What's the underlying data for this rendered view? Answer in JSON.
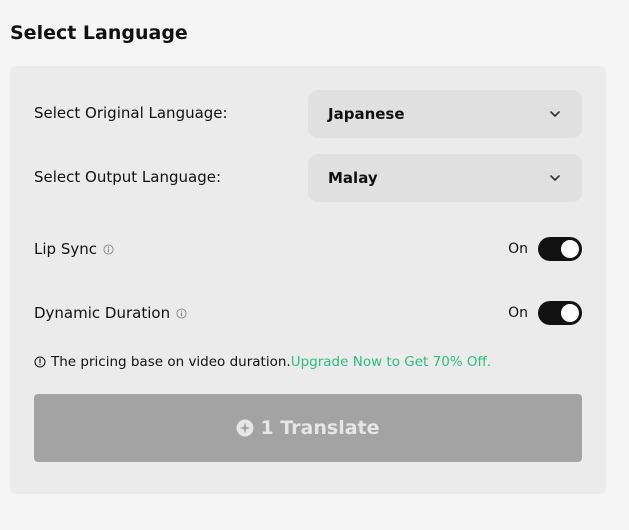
{
  "section": {
    "title": "Select Language"
  },
  "original_language": {
    "label": "Select Original Language:",
    "value": "Japanese"
  },
  "output_language": {
    "label": "Select Output Language:",
    "value": "Malay"
  },
  "lip_sync": {
    "label": "Lip Sync",
    "state": "On"
  },
  "dynamic_duration": {
    "label": "Dynamic Duration",
    "state": "On"
  },
  "pricing_note": {
    "text": "The pricing base on video duration.",
    "link": "Upgrade Now to Get 70% Off."
  },
  "translate_button": {
    "label": "1 Translate"
  },
  "icons": {
    "chevron": "chevron-down-icon",
    "info": "info-icon",
    "credit": "credit-coin-icon"
  },
  "colors": {
    "accent_link": "#2bbf7a",
    "toggle_on": "#111111",
    "button_disabled": "#a3a3a3"
  }
}
